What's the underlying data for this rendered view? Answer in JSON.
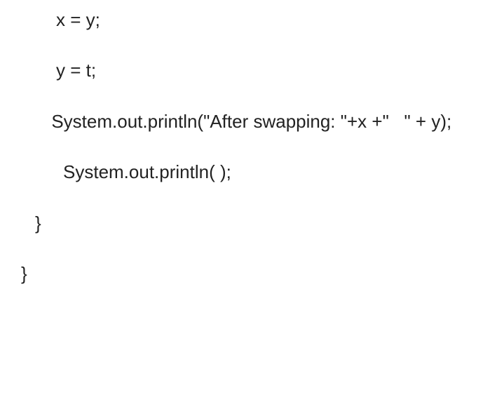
{
  "code": {
    "line1": "x = y;",
    "line2": "y = t;",
    "line3": "      System.out.println(\"After swapping: \"+x +\"   \" + y);",
    "line4": "System.out.println( );",
    "line5": "}",
    "line6": "}"
  }
}
